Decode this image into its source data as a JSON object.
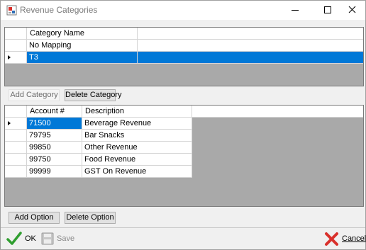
{
  "window": {
    "title": "Revenue Categories"
  },
  "categories": {
    "headers": [
      "Category Name"
    ],
    "rows": [
      {
        "name": "No Mapping",
        "selected": false
      },
      {
        "name": "T3",
        "selected": true
      }
    ]
  },
  "category_buttons": {
    "add": "Add Category",
    "delete": "Delete Category"
  },
  "options": {
    "headers": [
      "Account #",
      "Description"
    ],
    "rows": [
      {
        "account": "71500",
        "description": "Beverage Revenue",
        "current": true
      },
      {
        "account": "79795",
        "description": "Bar Snacks",
        "current": false
      },
      {
        "account": "99850",
        "description": "Other Revenue",
        "current": false
      },
      {
        "account": "99750",
        "description": "Food Revenue",
        "current": false
      },
      {
        "account": "99999",
        "description": "GST On Revenue",
        "current": false
      }
    ]
  },
  "option_buttons": {
    "add": "Add Option",
    "delete": "Delete Option"
  },
  "footer": {
    "ok": "OK",
    "save": "Save",
    "cancel": "Cancel"
  },
  "colors": {
    "selection": "#0078d7",
    "ok_check": "#2f9e2f",
    "cancel_x": "#d9302b",
    "grid_empty": "#a9a9a9"
  },
  "icons": {
    "app": "app-icon",
    "minimize": "minimize-icon",
    "maximize": "maximize-icon",
    "close": "close-icon",
    "ok": "checkmark-icon",
    "save": "floppy-disk-icon",
    "cancel": "red-x-icon",
    "row_pointer": "row-pointer-icon"
  }
}
